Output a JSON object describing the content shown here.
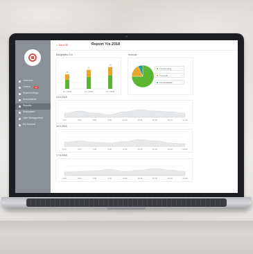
{
  "app": {
    "title": "Report Y/s 2018",
    "back_label": "< Back/Bi"
  },
  "sidebar": {
    "items": [
      {
        "label": "Overview",
        "active": false
      },
      {
        "label": "Orders",
        "badge": "10",
        "active": false
      },
      {
        "label": "Shareholdings",
        "active": false
      },
      {
        "label": "Accountants",
        "active": false
      },
      {
        "label": "Reports",
        "active": true
      },
      {
        "label": "Employees",
        "active": false
      },
      {
        "label": "User Management",
        "active": false
      },
      {
        "label": "My Account",
        "active": false
      }
    ]
  },
  "panels": {
    "bar_title": "Bar/graphic 1/4",
    "pie_title": "Item/pie"
  },
  "legend": [
    {
      "label": "Y/s Incoming",
      "color": "#5cb531"
    },
    {
      "label": "Y/s costs",
      "color": "#e8a52a"
    },
    {
      "label": "Y/s worldwide",
      "color": "#2a9d8f"
    }
  ],
  "area_charts": [
    {
      "label": "15.5.2018"
    },
    {
      "label": "16.5.2018"
    },
    {
      "label": "17.5.2018"
    }
  ],
  "chart_data": [
    {
      "type": "bar",
      "categories": [
        "10.7.2018",
        "10.7.2018",
        "10.7.2018"
      ],
      "series": [
        {
          "values": [
            10,
            13,
            15
          ],
          "color": "#5cb531"
        },
        {
          "values": [
            6,
            8,
            9
          ],
          "color": "#e8a52a"
        }
      ],
      "data_labels": [
        "16",
        "21",
        "24"
      ],
      "ylim": [
        0,
        26
      ]
    },
    {
      "type": "pie",
      "values": [
        75,
        18,
        7
      ],
      "colors": [
        "#5cb531",
        "#e8a52a",
        "#2a9d8f"
      ]
    },
    {
      "type": "area",
      "x": [
        "0:00",
        "3:00",
        "6:00",
        "9:00",
        "12:00",
        "15:00",
        "18:00",
        "21:00",
        "24:00"
      ],
      "values": [
        30,
        45,
        30,
        20,
        40,
        55,
        45,
        40,
        30
      ],
      "ylim": [
        0,
        100
      ]
    },
    {
      "type": "area",
      "x": [
        "0:00",
        "3:00",
        "6:00",
        "9:00",
        "12:00",
        "15:00",
        "18:00",
        "21:00",
        "24:00"
      ],
      "values": [
        30,
        40,
        30,
        25,
        35,
        50,
        40,
        25,
        20
      ],
      "ylim": [
        0,
        100
      ]
    },
    {
      "type": "area",
      "x": [
        "0:00",
        "3:00",
        "6:00",
        "9:00",
        "12:00",
        "15:00",
        "18:00",
        "21:00",
        "24:00"
      ],
      "values": [
        25,
        30,
        35,
        45,
        30,
        40,
        50,
        40,
        30
      ],
      "ylim": [
        0,
        100
      ]
    }
  ]
}
